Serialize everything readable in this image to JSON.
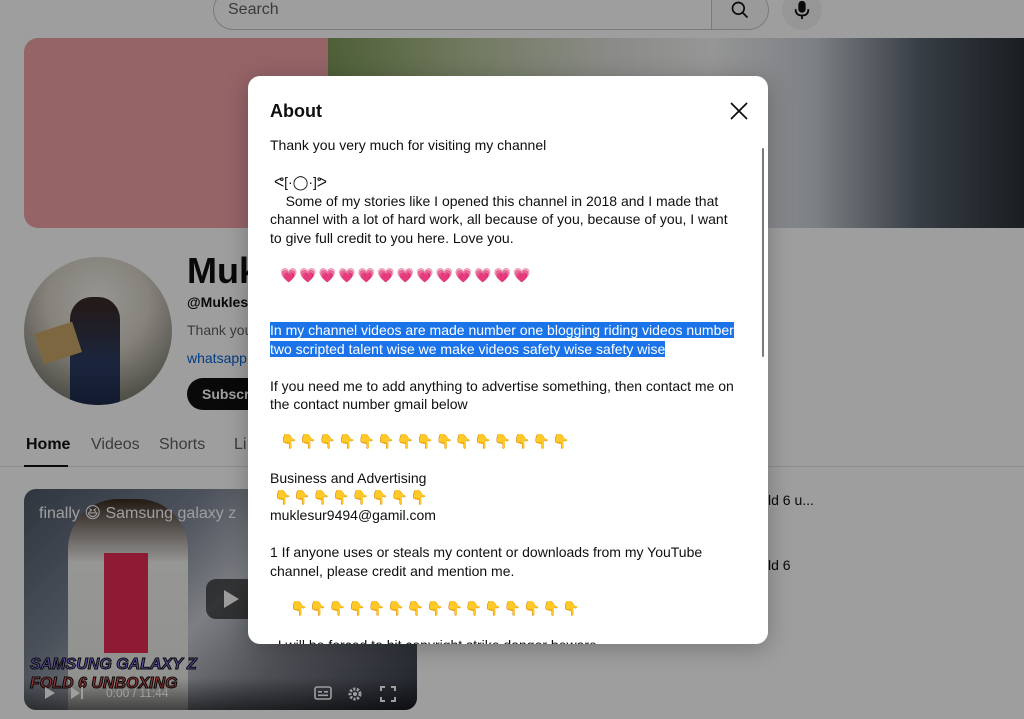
{
  "search": {
    "placeholder": "Search"
  },
  "channel": {
    "name": "Muk",
    "handle": "@Muklesur",
    "description": "Thank you",
    "link": "whatsapp.",
    "subscribe_label": "Subscri"
  },
  "tabs": [
    {
      "label": "Home",
      "active": true
    },
    {
      "label": "Videos",
      "active": false
    },
    {
      "label": "Shorts",
      "active": false
    },
    {
      "label": "Li",
      "active": false
    }
  ],
  "video": {
    "title": "finally 😆 Samsung galaxy z",
    "overlay_line1": "SAMSUNG GALAXY Z",
    "overlay_line2": "FOLD 6 UNBOXING",
    "time": "0:00 / 11:44"
  },
  "side_titles": [
    "ld 6 u...",
    "ld 6"
  ],
  "about": {
    "title": "About",
    "paragraphs": [
      "Thank you very much for visiting my channel",
      "ᕙ[·◯·]ᕗ",
      "    Some of my stories like I opened this channel in 2018 and I made that channel with a lot of hard work, all because of you, because of you, I want to give full credit to you here. Love you.",
      "💗💗💗💗💗💗💗💗💗💗💗💗💗",
      "In my channel videos are made number one blogging riding videos number two scripted talent wise we make videos safety wise safety wise",
      "If you need me to add anything to advertise something, then contact me on the contact number gmail below",
      "👇👇👇👇👇👇👇👇👇👇👇👇👇👇👇",
      "Business and Advertising",
      "👇👇👇👇👇👇👇👇",
      "muklesur9494@gamil.com",
      "1 If anyone uses or steals my content or downloads from my YouTube channel, please credit and mention me.",
      "👇👇👇👇👇👇👇👇👇👇👇👇👇👇👇",
      "  I will be forced to hit copyright strike danger beware"
    ]
  },
  "icons": {
    "search": "search-icon",
    "mic": "mic-icon",
    "close": "close-icon",
    "play": "play-icon",
    "subtitles": "subtitles-icon",
    "settings": "gear-icon",
    "fullscreen": "fullscreen-icon"
  },
  "colors": {
    "highlight": "#1a73e8",
    "link": "#065fd4",
    "subscribe_bg": "#0f0f0f"
  }
}
